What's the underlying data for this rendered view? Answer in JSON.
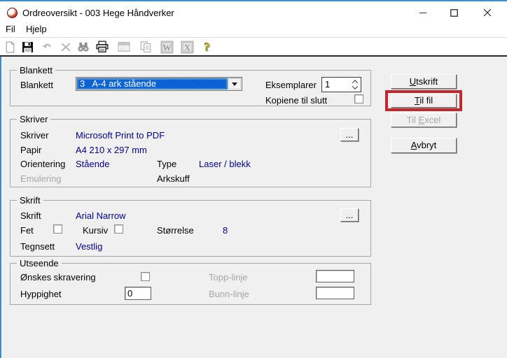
{
  "window": {
    "title": "Ordreoversikt - 003 Hege Håndverker",
    "controls": [
      "minimize",
      "maximize",
      "close"
    ]
  },
  "menu": {
    "items": [
      {
        "label": "Fil"
      },
      {
        "label": "Hjelp"
      }
    ]
  },
  "toolbar": {
    "icons": [
      {
        "name": "new-document",
        "enabled": true
      },
      {
        "name": "save",
        "enabled": true
      },
      {
        "name": "undo",
        "enabled": false
      },
      {
        "name": "delete",
        "enabled": false
      },
      {
        "name": "find",
        "enabled": false
      },
      {
        "name": "print",
        "enabled": true
      },
      {
        "name": "print-preview",
        "enabled": false
      },
      {
        "name": "copy",
        "enabled": false
      },
      {
        "name": "word-export",
        "enabled": false
      },
      {
        "name": "excel-export",
        "enabled": false
      },
      {
        "name": "help",
        "enabled": true
      }
    ]
  },
  "blankett": {
    "group_title": "Blankett",
    "field_label": "Blankett",
    "selected_option": "3   A-4 ark stående",
    "eksemplarer_label": "Eksemplarer",
    "eksemplarer_value": "1",
    "kopiene_label": "Kopiene til slutt",
    "kopiene_checked": false
  },
  "skriver": {
    "group_title": "Skriver",
    "skriver_label": "Skriver",
    "skriver_value": "Microsoft Print to PDF",
    "papir_label": "Papir",
    "papir_value": "A4 210 x 297 mm",
    "orientering_label": "Orientering",
    "orientering_value": "Stående",
    "type_label": "Type",
    "type_value": "Laser / blekk",
    "emulering_label": "Emulering",
    "arkskuff_label": "Arkskuff",
    "browse_label": "..."
  },
  "skrift": {
    "group_title": "Skrift",
    "skrift_label": "Skrift",
    "skrift_value": "Arial Narrow",
    "fet_label": "Fet",
    "fet_checked": false,
    "kursiv_label": "Kursiv",
    "kursiv_checked": false,
    "storrelse_label": "Størrelse",
    "storrelse_value": "8",
    "tegnsett_label": "Tegnsett",
    "tegnsett_value": "Vestlig",
    "browse_label": "..."
  },
  "utseende": {
    "group_title": "Utseende",
    "skravering_label": "Ønskes skravering",
    "skravering_checked": false,
    "hyppighet_label": "Hyppighet",
    "hyppighet_value": "0",
    "topp_label": "Topp-linje",
    "topp_value": "",
    "bunn_label": "Bunn-linje",
    "bunn_value": ""
  },
  "actions": {
    "utskrift": {
      "label": "Utskrift",
      "mnemonic": "U"
    },
    "til_fil": {
      "label": "Til fil",
      "mnemonic": "T"
    },
    "til_excel": {
      "label": "Til Excel",
      "mnemonic": "E"
    },
    "avbryt": {
      "label": "Avbryt",
      "mnemonic": "A"
    }
  },
  "colors": {
    "accent_border": "#3e8fc7",
    "value_text": "#00008b",
    "selection_bg": "#0a63d4",
    "highlight_box": "#c4262c"
  }
}
